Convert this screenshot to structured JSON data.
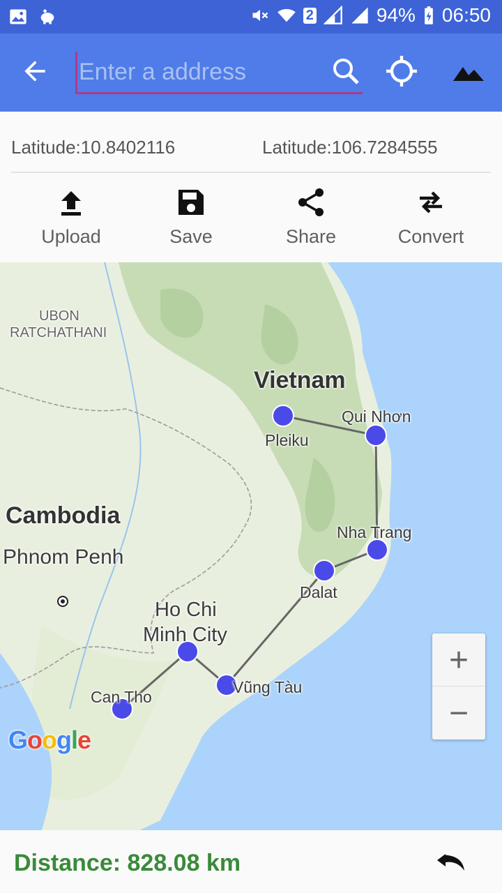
{
  "status_bar": {
    "battery": "94%",
    "time": "06:50",
    "sim_badge": "2",
    "icons": [
      "image-icon",
      "piggy-bank-icon",
      "mute-icon",
      "wifi-icon",
      "signal-icon",
      "battery-icon"
    ]
  },
  "toolbar": {
    "address_placeholder": "Enter a address",
    "icons": [
      "back-arrow-icon",
      "search-icon",
      "my-location-icon",
      "terrain-icon"
    ]
  },
  "coords": {
    "latitude_label": "Latitude:10.8402116",
    "longitude_label": "Latitude:106.7284555"
  },
  "actions": [
    {
      "label": "Upload",
      "icon": "upload-icon"
    },
    {
      "label": "Save",
      "icon": "save-icon"
    },
    {
      "label": "Share",
      "icon": "share-icon"
    },
    {
      "label": "Convert",
      "icon": "swap-icon"
    }
  ],
  "map": {
    "labels": {
      "ubon": "UBON",
      "ratchathani": "RATCHATHANI",
      "vietnam": "Vietnam",
      "cambodia": "Cambodia",
      "phnom_penh": "Phnom Penh",
      "pleiku": "Pleiku",
      "qui_nhon": "Qui Nhơn",
      "nha_trang": "Nha Trang",
      "dalat": "Dalat",
      "hcmc_1": "Ho Chi",
      "hcmc_2": "Minh City",
      "vung_tau": "Vũng Tàu",
      "can_tho": "Can Tho"
    },
    "route_points": [
      "Pleiku",
      "Qui Nhơn",
      "Nha Trang",
      "Dalat",
      "Vũng Tàu",
      "Ho Chi Minh City",
      "Can Tho"
    ],
    "zoom_in": "+",
    "zoom_out": "−",
    "attribution": "Google",
    "marker_color": "#4a4ae8"
  },
  "bottom": {
    "distance": "Distance: 828.08 km",
    "undo_icon": "undo-icon"
  }
}
